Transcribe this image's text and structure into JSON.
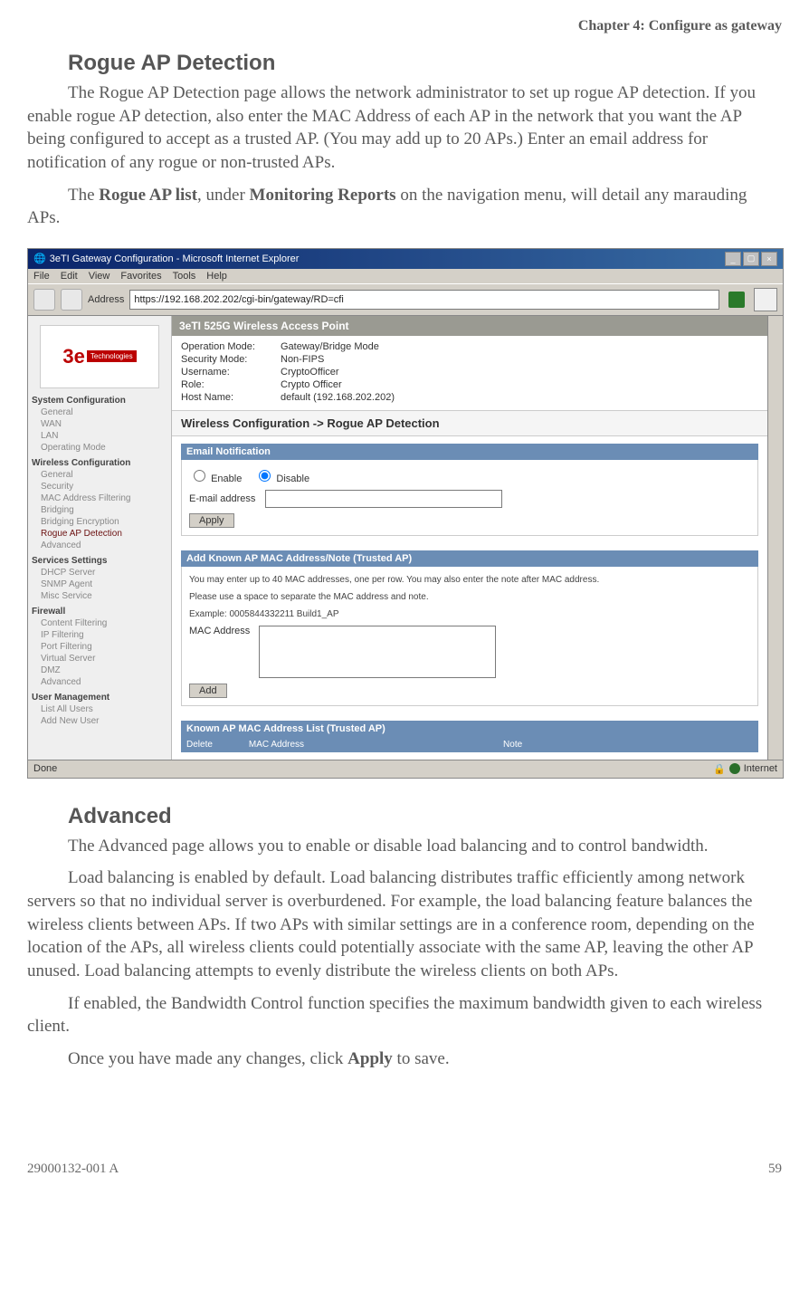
{
  "chapterHeader": "Chapter 4: Configure as gateway",
  "section1": {
    "heading": "Rogue AP Detection",
    "p1": "The Rogue AP Detection page allows the network administrator to set up rogue AP detection. If you enable rogue AP detection, also enter the MAC Address of each AP in the network that you want the AP being configured to accept as a trusted AP. (You may add up to 20 APs.)  Enter an email address for notification of any rogue or non-trusted APs.",
    "p2_pre": "The ",
    "p2_b1": "Rogue AP list",
    "p2_mid": ", under ",
    "p2_b2": "Monitoring Reports",
    "p2_post": " on the navigation menu, will detail any marauding APs."
  },
  "screenshot": {
    "windowTitle": "3eTI Gateway Configuration - Microsoft Internet Explorer",
    "menu": {
      "file": "File",
      "edit": "Edit",
      "view": "View",
      "favorites": "Favorites",
      "tools": "Tools",
      "help": "Help"
    },
    "addressLabel": "Address",
    "addressValue": "https://192.168.202.202/cgi-bin/gateway/RD=cfi",
    "goLabel": "Go",
    "topbar": "3eTI 525G Wireless Access Point",
    "info": {
      "opModeLabel": "Operation Mode:",
      "opMode": "Gateway/Bridge Mode",
      "secModeLabel": "Security Mode:",
      "secMode": "Non-FIPS",
      "userLabel": "Username:",
      "user": "CryptoOfficer",
      "roleLabel": "Role:",
      "role": "Crypto Officer",
      "hostLabel": "Host Name:",
      "host": "default (192.168.202.202)"
    },
    "breadcrumb": "Wireless Configuration -> Rogue AP Detection",
    "nav": {
      "g1": "System Configuration",
      "g1a": "General",
      "g1b": "WAN",
      "g1c": "LAN",
      "g1d": "Operating Mode",
      "g2": "Wireless Configuration",
      "g2a": "General",
      "g2b": "Security",
      "g2c": "MAC Address Filtering",
      "g2d": "Bridging",
      "g2e": "Bridging Encryption",
      "g2f": "Rogue AP Detection",
      "g2g": "Advanced",
      "g3": "Services Settings",
      "g3a": "DHCP Server",
      "g3b": "SNMP Agent",
      "g3c": "Misc Service",
      "g4": "Firewall",
      "g4a": "Content Filtering",
      "g4b": "IP Filtering",
      "g4c": "Port Filtering",
      "g4d": "Virtual Server",
      "g4e": "DMZ",
      "g4f": "Advanced",
      "g5": "User Management",
      "g5a": "List All Users",
      "g5b": "Add New User"
    },
    "emailPanel": {
      "header": "Email Notification",
      "enable": "Enable",
      "disable": "Disable",
      "emailLabel": "E-mail address",
      "apply": "Apply"
    },
    "macPanel": {
      "header": "Add Known AP MAC Address/Note (Trusted AP)",
      "note1": "You may enter up to 40 MAC addresses, one per row. You may also enter the note after MAC address.",
      "note2": "Please use a space to separate the MAC address and note.",
      "note3": "Example: 0005844332211 Build1_AP",
      "macLabel": "MAC Address",
      "add": "Add"
    },
    "listPanel": {
      "header": "Known AP MAC Address List (Trusted AP)",
      "col1": "Delete",
      "col2": "MAC Address",
      "col3": "Note"
    },
    "status": {
      "done": "Done",
      "internet": "Internet"
    }
  },
  "section2": {
    "heading": "Advanced",
    "p1": "The Advanced page allows you to enable or disable load balancing and to control bandwidth.",
    "p2": "Load balancing is enabled by default. Load balancing distributes traffic efficiently among network servers so that no individual server is overburdened. For example, the load balancing feature balances the wireless clients between APs.  If two APs with similar settings are in a conference room, depending on the location of the APs, all wireless clients could potentially associate with the same AP, leaving the other AP unused.  Load balancing attempts to evenly distribute the wireless clients on both APs.",
    "p3": "If enabled, the Bandwidth Control function specifies the maximum bandwidth given to each wireless client.",
    "p4_pre": "Once you have made any changes, click ",
    "p4_b": "Apply",
    "p4_post": " to save."
  },
  "footer": {
    "docnum": "29000132-001 A",
    "page": "59"
  }
}
